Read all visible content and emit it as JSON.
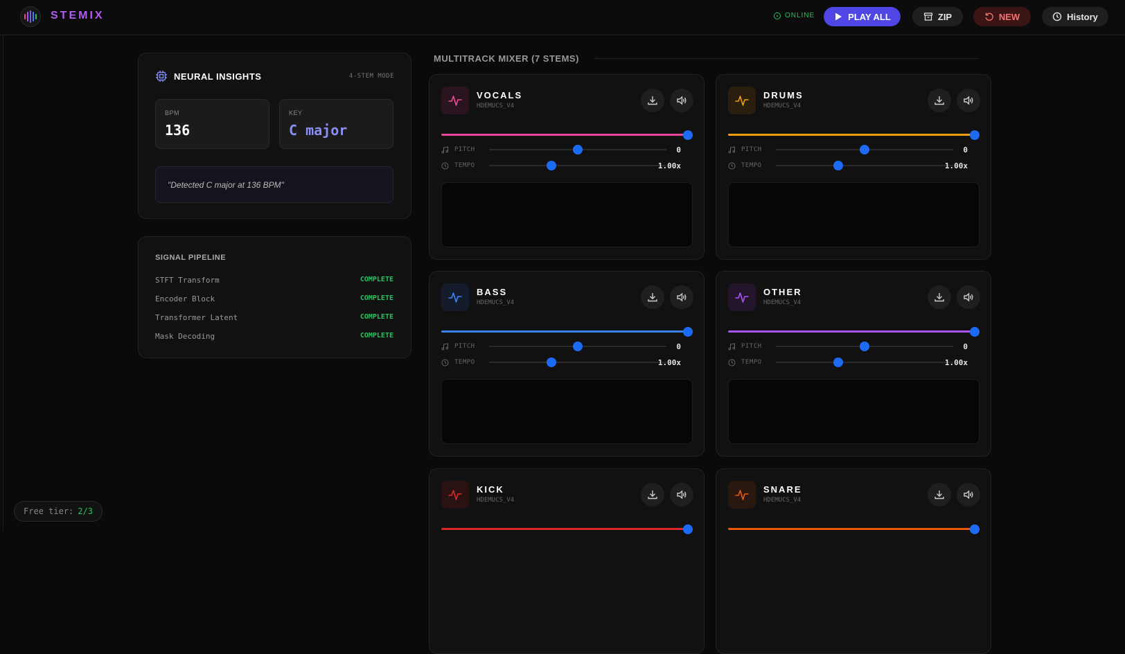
{
  "header": {
    "brand": "STEMIX",
    "status": "ONLINE",
    "play_all": "PLAY ALL",
    "zip": "ZIP",
    "new": "NEW",
    "history": "History"
  },
  "insights": {
    "title": "NEURAL INSIGHTS",
    "mode": "4-STEM MODE",
    "bpm_label": "BPM",
    "bpm": "136",
    "key_label": "KEY",
    "key": "C major",
    "note": "\"Detected C major at 136 BPM\""
  },
  "pipeline": {
    "title": "SIGNAL PIPELINE",
    "steps": [
      {
        "name": "STFT Transform",
        "status": "COMPLETE"
      },
      {
        "name": "Encoder Block",
        "status": "COMPLETE"
      },
      {
        "name": "Transformer Latent",
        "status": "COMPLETE"
      },
      {
        "name": "Mask Decoding",
        "status": "COMPLETE"
      }
    ]
  },
  "mixer": {
    "title": "MULTITRACK MIXER (7 STEMS)",
    "pitch_label": "PITCH",
    "tempo_label": "TEMPO",
    "stems": [
      {
        "name": "VOCALS",
        "model": "HDEMUCS_V4",
        "color": "#ec4899",
        "icon_bg": "#2a1420",
        "volume": 1.0,
        "pitch": "0",
        "pitch_level": 0.5,
        "tempo": "1.00x",
        "tempo_level": 0.35
      },
      {
        "name": "DRUMS",
        "model": "HDEMUCS_V4",
        "color": "#f59e0b",
        "icon_bg": "#2a1e0e",
        "volume": 1.0,
        "pitch": "0",
        "pitch_level": 0.5,
        "tempo": "1.00x",
        "tempo_level": 0.35
      },
      {
        "name": "BASS",
        "model": "HDEMUCS_V4",
        "color": "#3b82f6",
        "icon_bg": "#141c2c",
        "volume": 1.0,
        "pitch": "0",
        "pitch_level": 0.5,
        "tempo": "1.00x",
        "tempo_level": 0.35
      },
      {
        "name": "OTHER",
        "model": "HDEMUCS_V4",
        "color": "#a855f7",
        "icon_bg": "#22152c",
        "volume": 1.0,
        "pitch": "0",
        "pitch_level": 0.5,
        "tempo": "1.00x",
        "tempo_level": 0.35
      },
      {
        "name": "KICK",
        "model": "HDEMUCS_V4",
        "color": "#dc2626",
        "icon_bg": "#2a1212",
        "volume": 1.0
      },
      {
        "name": "SNARE",
        "model": "HDEMUCS_V4",
        "color": "#ea580c",
        "icon_bg": "#2a1810",
        "volume": 1.0
      }
    ]
  },
  "footer": {
    "free_label": "Free tier:",
    "free_count": "2/3"
  },
  "colors": {
    "accent": "#4f46e5",
    "knob": "#1d6bf5",
    "success": "#22c55e",
    "danger": "#f87171"
  }
}
